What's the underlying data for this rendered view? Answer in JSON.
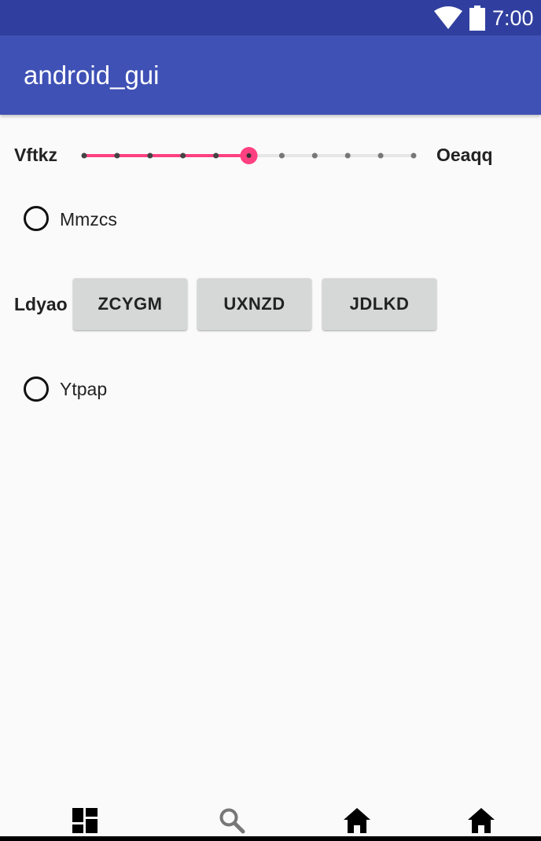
{
  "status_bar": {
    "time": "7:00",
    "icons": [
      "wifi-icon",
      "battery-icon"
    ],
    "color": "#303f9f"
  },
  "app_bar": {
    "title": "android_gui",
    "color": "#3f51b5"
  },
  "slider": {
    "left_label": "Vftkz",
    "right_label": "Oeaqq",
    "steps": 10,
    "value_step": 5,
    "accent_color": "#ff4081"
  },
  "radio_1": {
    "label": "Mmzcs",
    "checked": false
  },
  "button_group": {
    "label": "Ldyao",
    "buttons": [
      "ZCYGM",
      "UXNZD",
      "JDLKD"
    ]
  },
  "radio_2": {
    "label": "Ytpap",
    "checked": false
  },
  "bottom_nav": {
    "icons": [
      "dashboard-icon",
      "search-icon",
      "home-icon",
      "home-icon"
    ]
  }
}
